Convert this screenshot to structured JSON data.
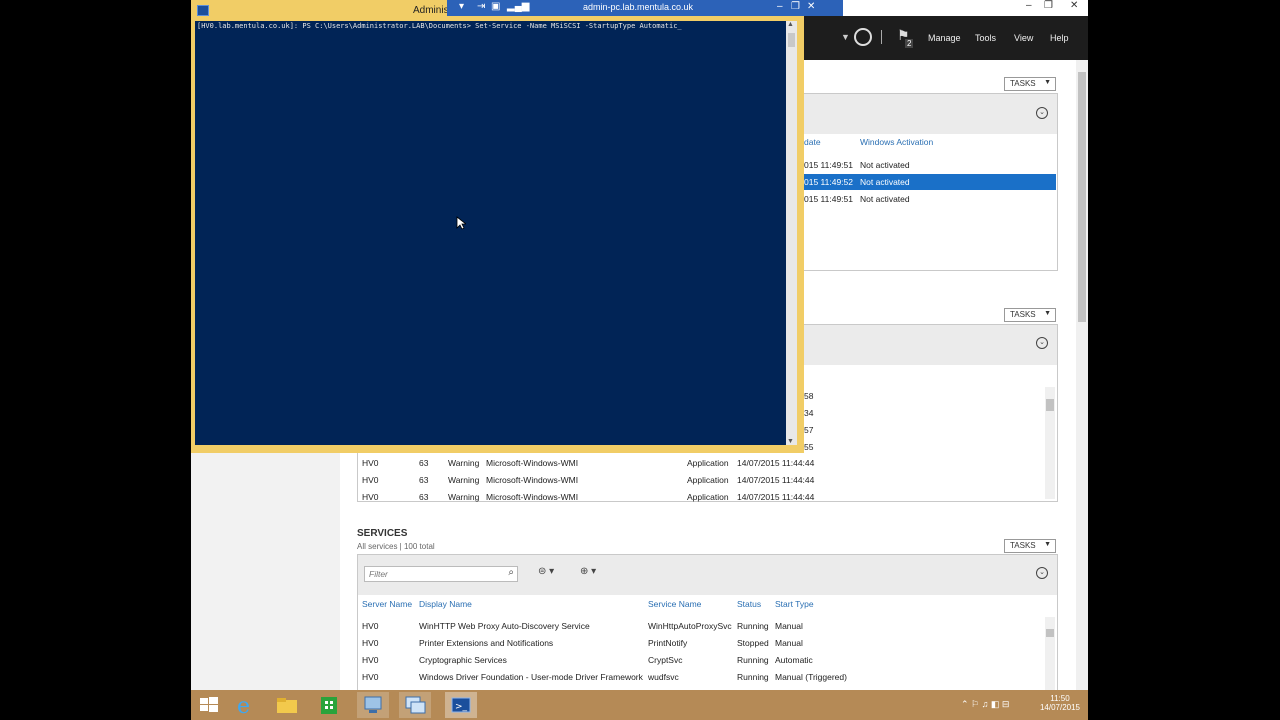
{
  "rdp_bar": {
    "title": "admin-pc.lab.mentula.co.uk"
  },
  "powershell": {
    "title": "Administrator: Windows PowerShell",
    "command_line": "[HV0.lab.mentula.co.uk]: PS C:\\Users\\Administrator.LAB\\Documents> Set-Service -Name MSiSCSI -StartupType Automatic_"
  },
  "server_manager": {
    "menu": {
      "manage": "Manage",
      "tools": "Tools",
      "view": "View",
      "help": "Help"
    },
    "notification_count": "2",
    "tasks_label": "TASKS",
    "servers_panel": {
      "columns": [
        "date",
        "Windows Activation"
      ],
      "rows": [
        {
          "date": "015 11:49:51",
          "activation": "Not activated",
          "selected": false
        },
        {
          "date": "015 11:49:52",
          "activation": "Not activated",
          "selected": true
        },
        {
          "date": "015 11:49:51",
          "activation": "Not activated",
          "selected": false
        }
      ]
    },
    "events_panel": {
      "partial_rows": [
        "58",
        "34",
        "57",
        "55"
      ],
      "rows": [
        {
          "server": "HV0",
          "id": "63",
          "severity": "Warning",
          "source": "Microsoft-Windows-WMI",
          "log": "Application",
          "date": "14/07/2015 11:44:44"
        },
        {
          "server": "HV0",
          "id": "63",
          "severity": "Warning",
          "source": "Microsoft-Windows-WMI",
          "log": "Application",
          "date": "14/07/2015 11:44:44"
        },
        {
          "server": "HV0",
          "id": "63",
          "severity": "Warning",
          "source": "Microsoft-Windows-WMI",
          "log": "Application",
          "date": "14/07/2015 11:44:44"
        }
      ]
    },
    "services": {
      "title": "SERVICES",
      "subtitle": "All services | 100 total",
      "filter_placeholder": "Filter",
      "columns": {
        "server": "Server Name",
        "display": "Display Name",
        "service": "Service Name",
        "status": "Status",
        "start": "Start Type"
      },
      "rows": [
        {
          "server": "HV0",
          "display": "WinHTTP Web Proxy Auto-Discovery Service",
          "service": "WinHttpAutoProxySvc",
          "status": "Running",
          "start": "Manual"
        },
        {
          "server": "HV0",
          "display": "Printer Extensions and Notifications",
          "service": "PrintNotify",
          "status": "Stopped",
          "start": "Manual"
        },
        {
          "server": "HV0",
          "display": "Cryptographic Services",
          "service": "CryptSvc",
          "status": "Running",
          "start": "Automatic"
        },
        {
          "server": "HV0",
          "display": "Windows Driver Foundation - User-mode Driver Framework",
          "service": "wudfsvc",
          "status": "Running",
          "start": "Manual (Triggered)"
        }
      ]
    }
  },
  "taskbar": {
    "time": "11:50",
    "date": "14/07/2015"
  },
  "colors": {
    "powershell_bg": "#012456",
    "frame": "#f1cd66",
    "selection": "#1a70c8",
    "taskbar": "#b58a56"
  }
}
